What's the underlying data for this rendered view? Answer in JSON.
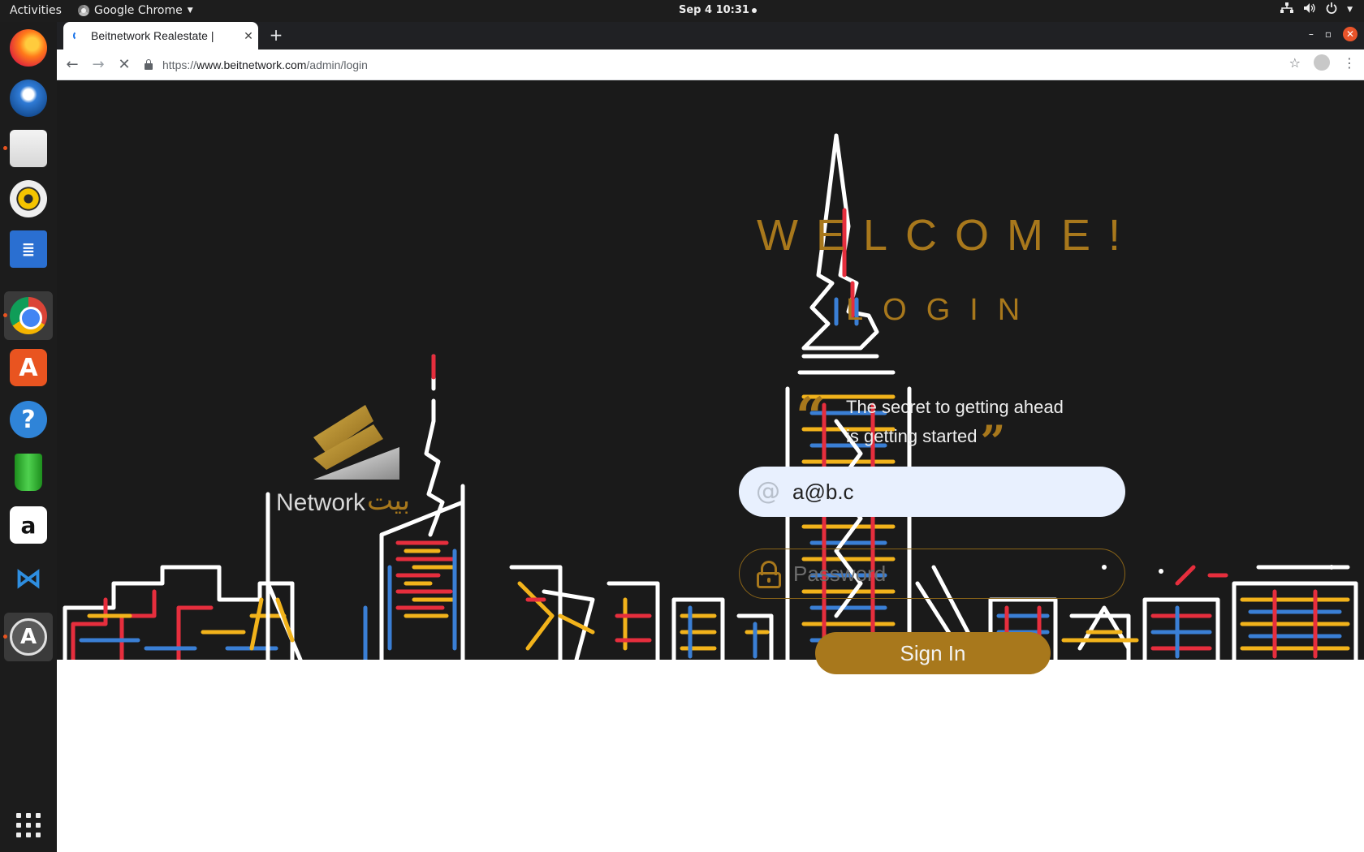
{
  "topbar": {
    "activities": "Activities",
    "app_name": "Google Chrome",
    "clock": "Sep 4  10:31"
  },
  "dock": {
    "items": [
      {
        "name": "firefox-icon"
      },
      {
        "name": "thunderbird-icon"
      },
      {
        "name": "files-icon"
      },
      {
        "name": "rhythmbox-icon"
      },
      {
        "name": "libreoffice-writer-icon"
      },
      {
        "name": "chrome-icon"
      },
      {
        "name": "ubuntu-software-icon"
      },
      {
        "name": "help-icon"
      },
      {
        "name": "green-pipe-icon"
      },
      {
        "name": "amazon-icon"
      },
      {
        "name": "vscode-icon"
      },
      {
        "name": "software-updater-icon"
      }
    ]
  },
  "browser": {
    "tab_title": "Beitnetwork Realestate | ",
    "url_scheme": "https://",
    "url_host": "www.beitnetwork.com",
    "url_path": "/admin/login"
  },
  "page": {
    "welcome": "WELCOME!",
    "login_title": "LOGIN",
    "quote_open": "“",
    "quote_close": "”",
    "quote_line1": "The secret to getting ahead",
    "quote_line2": "is getting started",
    "email_value": "a@b.c",
    "password_placeholder": "Password",
    "signin_label": "Sign In",
    "logo_text": "Network",
    "logo_arabic": "بيت"
  },
  "colors": {
    "accent_gold": "#a8781c",
    "hero_background": "#1a1a1a",
    "email_field_bg": "#e8f0fe"
  }
}
